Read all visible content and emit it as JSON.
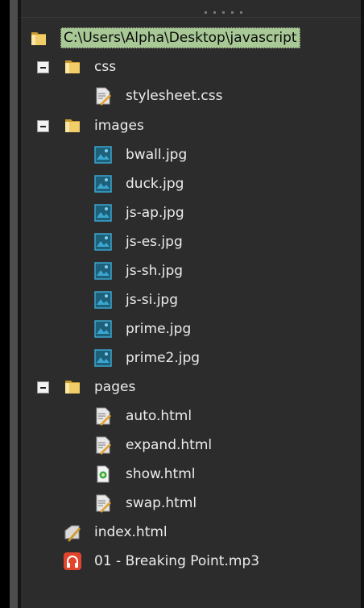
{
  "tree": {
    "root": {
      "label": "C:\\Users\\Alpha\\Desktop\\javascript",
      "icon": "folder-icon"
    },
    "folders": [
      {
        "label": "css",
        "icon": "folder-icon",
        "expanded": true,
        "children": [
          {
            "label": "stylesheet.css",
            "icon": "css-file-icon"
          }
        ]
      },
      {
        "label": "images",
        "icon": "folder-icon",
        "expanded": true,
        "children": [
          {
            "label": "bwall.jpg",
            "icon": "image-file-icon"
          },
          {
            "label": "duck.jpg",
            "icon": "image-file-icon"
          },
          {
            "label": "js-ap.jpg",
            "icon": "image-file-icon"
          },
          {
            "label": "js-es.jpg",
            "icon": "image-file-icon"
          },
          {
            "label": "js-sh.jpg",
            "icon": "image-file-icon"
          },
          {
            "label": "js-si.jpg",
            "icon": "image-file-icon"
          },
          {
            "label": "prime.jpg",
            "icon": "image-file-icon"
          },
          {
            "label": "prime2.jpg",
            "icon": "image-file-icon"
          }
        ]
      },
      {
        "label": "pages",
        "icon": "folder-icon",
        "expanded": true,
        "children": [
          {
            "label": "auto.html",
            "icon": "html-file-icon"
          },
          {
            "label": "expand.html",
            "icon": "html-file-icon"
          },
          {
            "label": "show.html",
            "icon": "html-special-file-icon"
          },
          {
            "label": "swap.html",
            "icon": "html-file-icon"
          }
        ]
      }
    ],
    "files": [
      {
        "label": "index.html",
        "icon": "html-edit-file-icon"
      },
      {
        "label": "01 - Breaking Point.mp3",
        "icon": "audio-file-icon"
      }
    ]
  },
  "colors": {
    "background": "#2c2c2c",
    "text": "#ececec",
    "selection": "#a8c896",
    "folder": "#e8c35a",
    "image_icon": "#2f8fb0",
    "audio_icon": "#e2452e"
  }
}
